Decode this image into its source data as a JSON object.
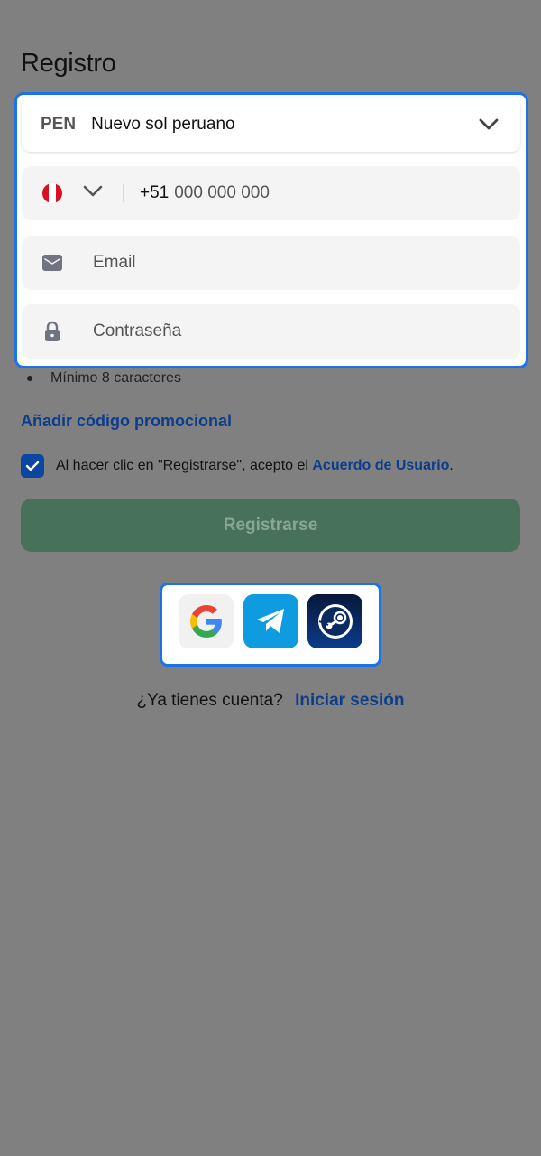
{
  "page": {
    "title": "Registro"
  },
  "currency": {
    "code": "PEN",
    "name": "Nuevo sol peruano"
  },
  "phone": {
    "prefix": "+51",
    "placeholder": "000 000 000",
    "country_flag": "peru-flag-icon"
  },
  "email": {
    "placeholder": "Email"
  },
  "password": {
    "placeholder": "Contraseña"
  },
  "password_hint": "Mínimo 8 caracteres",
  "promo_link": "Añadir código promocional",
  "agreement": {
    "text": "Al hacer clic en \"Registrarse\", acepto el ",
    "link": "Acuerdo de Usuario",
    "suffix": ".",
    "checked": true
  },
  "register_button": "Registrarse",
  "social": [
    {
      "name": "google",
      "icon": "google-icon"
    },
    {
      "name": "telegram",
      "icon": "telegram-icon"
    },
    {
      "name": "steam",
      "icon": "steam-icon"
    }
  ],
  "login": {
    "question": "¿Ya tienes cuenta?",
    "link": "Iniciar sesión"
  },
  "colors": {
    "overlay": "#808080",
    "accent_blue": "#1a73e8",
    "link": "#0b3d8c",
    "register_bg": "#47715a"
  }
}
